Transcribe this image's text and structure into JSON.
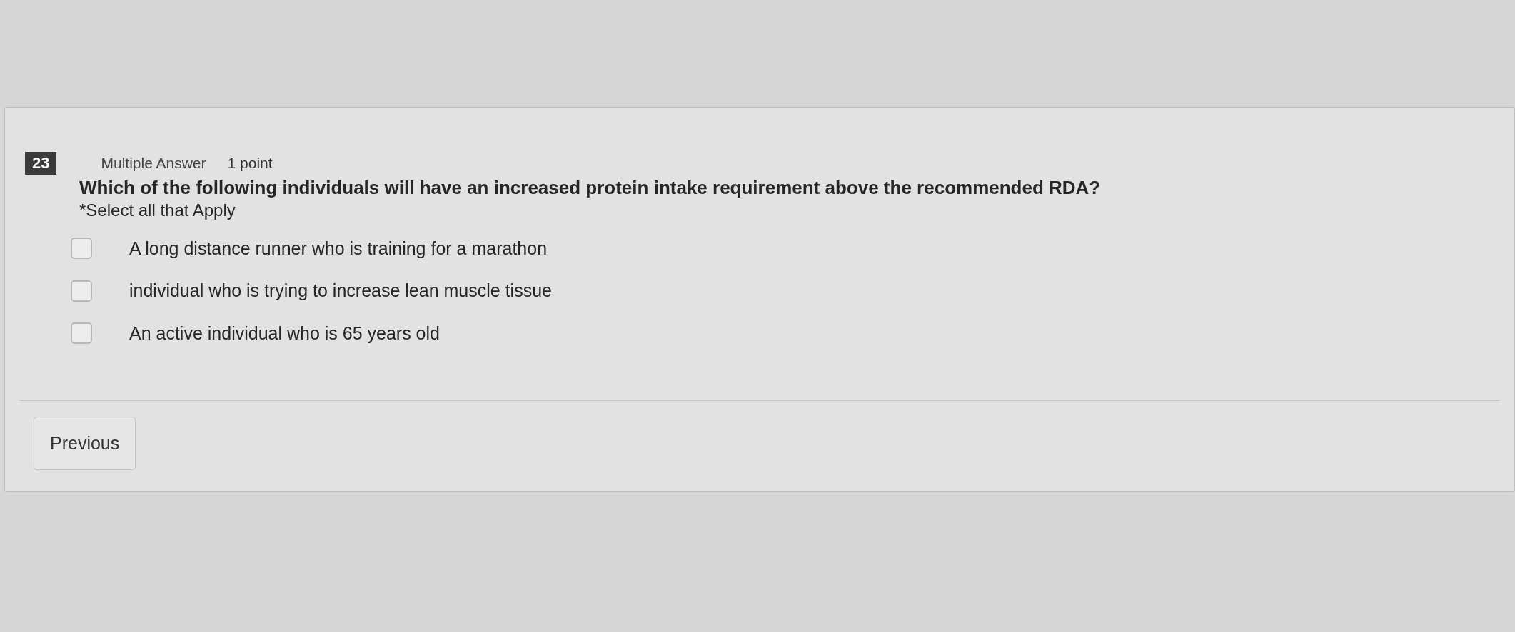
{
  "question": {
    "number": "23",
    "type": "Multiple Answer",
    "points": "1 point",
    "text": "Which of the following individuals will have an increased protein intake requirement above the recommended RDA?",
    "instruction": "*Select all that Apply"
  },
  "options": [
    {
      "label": "A long distance runner who is training for a marathon",
      "checked": false
    },
    {
      "label": "individual who is trying to increase lean muscle tissue",
      "checked": false
    },
    {
      "label": "An active individual who is 65 years old",
      "checked": false
    }
  ],
  "buttons": [
    {
      "label": "Previous"
    }
  ]
}
